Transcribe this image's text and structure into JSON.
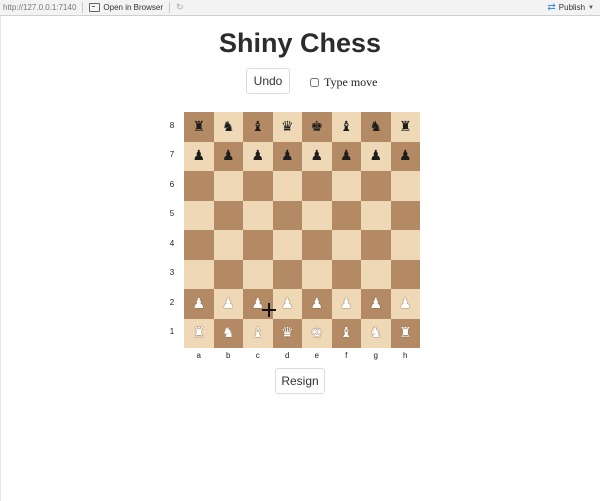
{
  "toolbar": {
    "url": "http://127.0.0.1:7140",
    "open_in_browser": "Open in Browser",
    "publish": "Publish"
  },
  "app": {
    "title": "Shiny Chess",
    "undo_label": "Undo",
    "type_move_label": "Type move",
    "resign_label": "Resign"
  },
  "board": {
    "files": [
      "a",
      "b",
      "c",
      "d",
      "e",
      "f",
      "g",
      "h"
    ],
    "ranks": [
      "8",
      "7",
      "6",
      "5",
      "4",
      "3",
      "2",
      "1"
    ],
    "light_color": "#efd8b6",
    "dark_color": "#b38a64",
    "rows": [
      [
        "bR",
        "bN",
        "bB",
        "bQ",
        "bK",
        "bB",
        "bN",
        "bR"
      ],
      [
        "bP",
        "bP",
        "bP",
        "bP",
        "bP",
        "bP",
        "bP",
        "bP"
      ],
      [
        "",
        "",
        "",
        "",
        "",
        "",
        "",
        ""
      ],
      [
        "",
        "",
        "",
        "",
        "",
        "",
        "",
        ""
      ],
      [
        "",
        "",
        "",
        "",
        "",
        "",
        "",
        ""
      ],
      [
        "",
        "",
        "",
        "",
        "",
        "",
        "",
        ""
      ],
      [
        "wP",
        "wP",
        "wP",
        "wP",
        "wP",
        "wP",
        "wP",
        "wP"
      ],
      [
        "wR",
        "wN",
        "wB",
        "wQ",
        "wK",
        "wB",
        "wN",
        "wR"
      ]
    ]
  },
  "icons": {
    "open_in_browser": "browser-window-icon",
    "refresh": "refresh-icon",
    "publish": "publish-icon"
  }
}
